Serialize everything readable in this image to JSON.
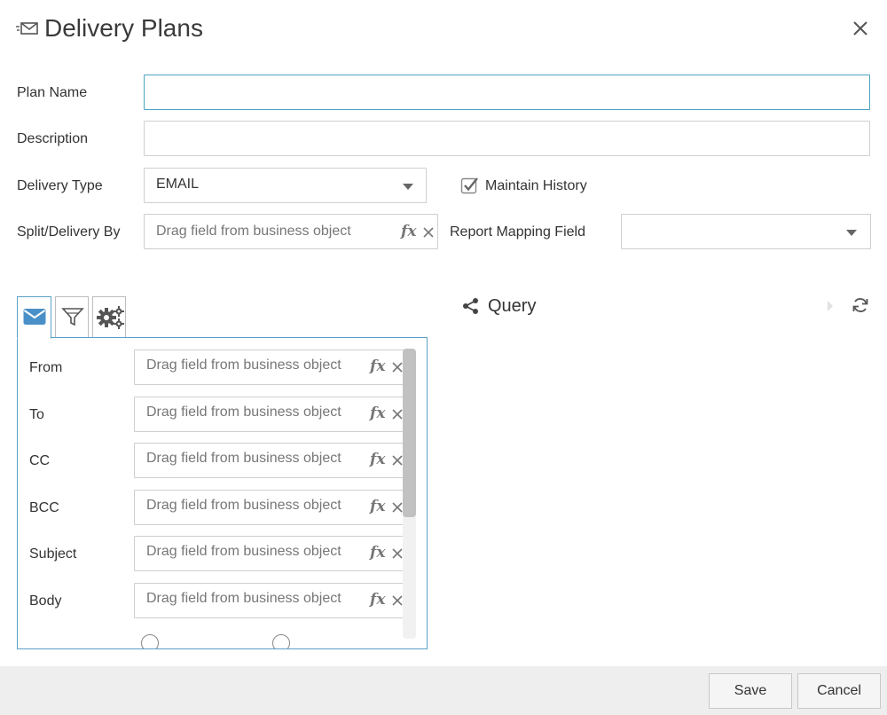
{
  "dialog": {
    "title": "Delivery Plans",
    "icon": "envelope-send-icon",
    "close_icon": "close-icon"
  },
  "form": {
    "plan_name_label": "Plan Name",
    "plan_name_value": "",
    "description_label": "Description",
    "description_value": "",
    "delivery_type_label": "Delivery Type",
    "delivery_type_value": "EMAIL",
    "maintain_history_label": "Maintain History",
    "maintain_history_checked": true,
    "split_label": "Split/Delivery By",
    "split_placeholder": "Drag field from business object",
    "report_mapping_label": "Report Mapping Field",
    "report_mapping_value": ""
  },
  "tabs": [
    {
      "name": "email-tab",
      "icon": "envelope-icon",
      "active": true
    },
    {
      "name": "filter-tab",
      "icon": "filter-icon",
      "active": false
    },
    {
      "name": "settings-tab",
      "icon": "gears-icon",
      "active": false
    }
  ],
  "email_fields": [
    {
      "label": "From",
      "placeholder": "Drag field from business object"
    },
    {
      "label": "To",
      "placeholder": "Drag field from business object"
    },
    {
      "label": "CC",
      "placeholder": "Drag field from business object"
    },
    {
      "label": "BCC",
      "placeholder": "Drag field from business object"
    },
    {
      "label": "Subject",
      "placeholder": "Drag field from business object"
    },
    {
      "label": "Body",
      "placeholder": "Drag field from business object"
    }
  ],
  "fx_label": "fx",
  "query": {
    "label": "Query",
    "icon": "share-icon",
    "refresh_icon": "refresh-icon",
    "play_icon": "play-icon"
  },
  "footer": {
    "save_label": "Save",
    "cancel_label": "Cancel"
  },
  "colors": {
    "accent": "#5aa0c8",
    "focus_border": "#4aa3c3",
    "footer_bg": "#eeeeee"
  }
}
